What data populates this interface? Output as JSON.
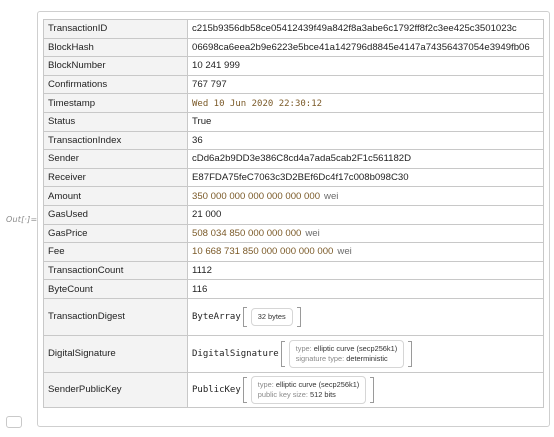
{
  "out_label": "Out[·]=",
  "rows": [
    {
      "key": "TransactionID",
      "value": "c215b9356db58ce05412439f49a842f8a3abe6c1792ff8f2c3ee425c3501023c"
    },
    {
      "key": "BlockHash",
      "value": "06698ca6eea2b9e6223e5bce41a142796d8845e4147a74356437054e3949fb06"
    },
    {
      "key": "BlockNumber",
      "value": "10 241 999"
    },
    {
      "key": "Confirmations",
      "value": "767 797"
    },
    {
      "key": "Timestamp",
      "value": "Wed 10 Jun 2020 22:30:12"
    },
    {
      "key": "Status",
      "value": "True"
    },
    {
      "key": "TransactionIndex",
      "value": "36"
    },
    {
      "key": "Sender",
      "value": "cDd6a2b9DD3e386C8cd4a7ada5cab2F1c561182D"
    },
    {
      "key": "Receiver",
      "value": "E87FDA75feC7063c3D2BEf6Dc4f17c008b098C30"
    },
    {
      "key": "Amount",
      "value": "350 000 000 000 000 000 000",
      "unit": "wei"
    },
    {
      "key": "GasUsed",
      "value": "21 000"
    },
    {
      "key": "GasPrice",
      "value": "508 034 850 000 000 000",
      "unit": "wei"
    },
    {
      "key": "Fee",
      "value": "10 668 731 850 000 000 000 000",
      "unit": "wei"
    },
    {
      "key": "TransactionCount",
      "value": "1112"
    },
    {
      "key": "ByteCount",
      "value": "116"
    }
  ],
  "digest": {
    "key": "TransactionDigest",
    "head": "ByteArray",
    "box": "32 bytes"
  },
  "signature": {
    "key": "DigitalSignature",
    "head": "DigitalSignature",
    "type_label": "type:",
    "type_value": "elliptic curve (secp256k1)",
    "sig_label": "signature type:",
    "sig_value": "deterministic"
  },
  "pubkey": {
    "key": "SenderPublicKey",
    "head": "PublicKey",
    "type_label": "type:",
    "type_value": "elliptic curve (secp256k1)",
    "size_label": "public key size:",
    "size_value": "512 bits"
  }
}
